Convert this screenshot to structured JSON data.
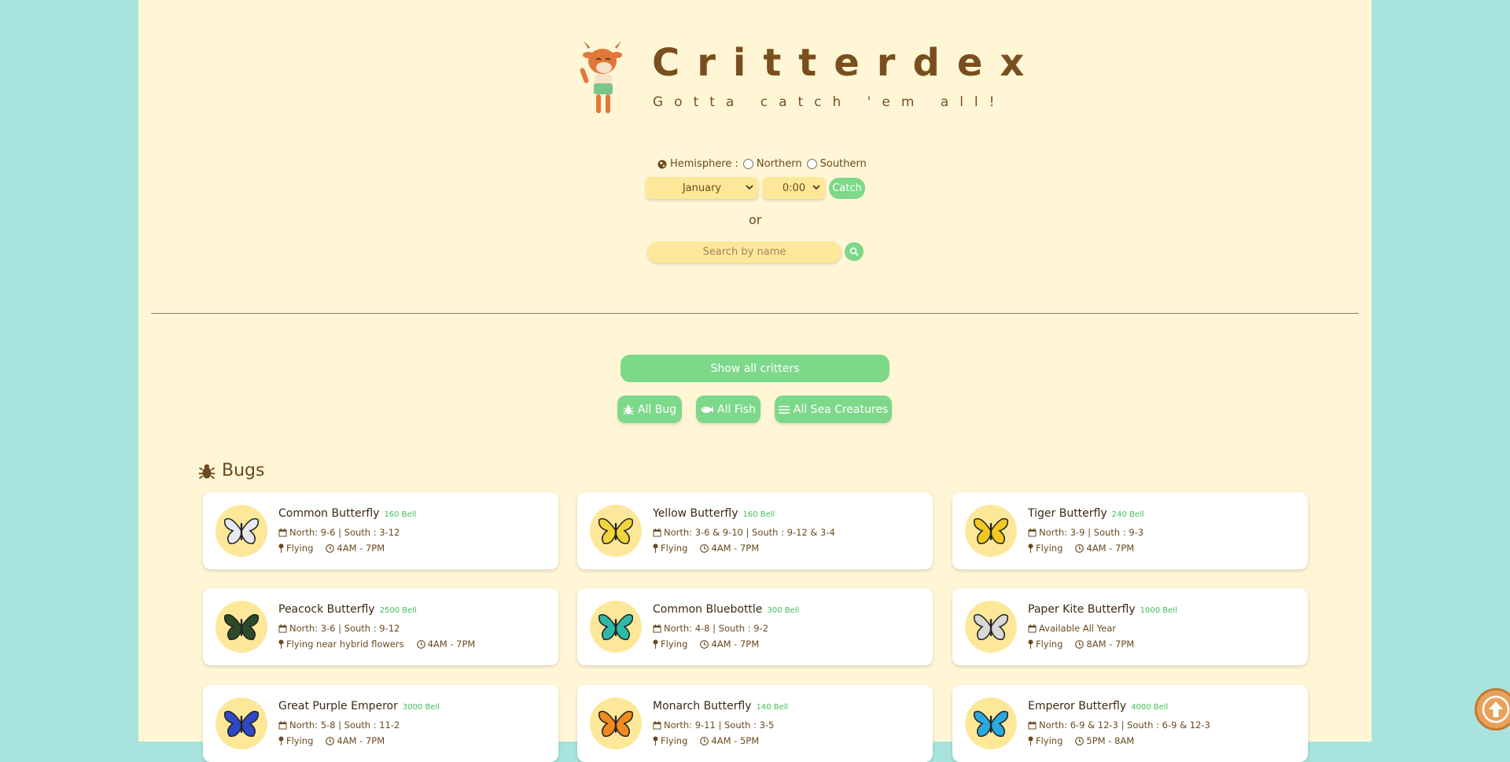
{
  "header": {
    "title": "Critterdex",
    "subtitle": "Gotta catch 'em all!"
  },
  "filter": {
    "hemisphere_label": "Hemisphere :",
    "northern_label": "Northern",
    "southern_label": "Southern",
    "month_value": "January",
    "time_value": "0:00",
    "catch_label": "Catch",
    "or_label": "or",
    "search_placeholder": "Search by name"
  },
  "nav": {
    "show_all_label": "Show all critters",
    "all_bug_label": "All Bug",
    "all_fish_label": "All Fish",
    "all_sea_label": "All Sea Creatures"
  },
  "section": {
    "title": "Bugs"
  },
  "cards": [
    {
      "name": "Common Butterfly",
      "price": "160 Bell",
      "season": "North: 9-6 | South : 3-12",
      "location": "Flying",
      "time": "4AM - 7PM",
      "color": "#e8e8f0"
    },
    {
      "name": "Yellow Butterfly",
      "price": "160 Bell",
      "season": "North: 3-6 & 9-10 | South : 9-12 & 3-4",
      "location": "Flying",
      "time": "4AM - 7PM",
      "color": "#f1d53a"
    },
    {
      "name": "Tiger Butterfly",
      "price": "240 Bell",
      "season": "North: 3-9 | South : 9-3",
      "location": "Flying",
      "time": "4AM - 7PM",
      "color": "#f3c820"
    },
    {
      "name": "Peacock Butterfly",
      "price": "2500 Bell",
      "season": "North: 3-6 | South : 9-12",
      "location": "Flying near hybrid flowers",
      "time": "4AM - 7PM",
      "color": "#2c4a2a"
    },
    {
      "name": "Common Bluebottle",
      "price": "300 Bell",
      "season": "North: 4-8 | South : 9-2",
      "location": "Flying",
      "time": "4AM - 7PM",
      "color": "#2fb8a8"
    },
    {
      "name": "Paper Kite Butterfly",
      "price": "1000 Bell",
      "season": "Available All Year",
      "location": "Flying",
      "time": "8AM - 7PM",
      "color": "#d8d8d8"
    },
    {
      "name": "Great Purple Emperor",
      "price": "3000 Bell",
      "season": "North: 5-8 | South : 11-2",
      "location": "Flying",
      "time": "4AM - 7PM",
      "color": "#2f48c8"
    },
    {
      "name": "Monarch Butterfly",
      "price": "140 Bell",
      "season": "North: 9-11 | South : 3-5",
      "location": "Flying",
      "time": "4AM - 5PM",
      "color": "#f08a20"
    },
    {
      "name": "Emperor Butterfly",
      "price": "4000 Bell",
      "season": "North: 6-9 & 12-3 | South : 6-9 & 12-3",
      "location": "Flying",
      "time": "5PM - 8AM",
      "color": "#2aa8e0"
    }
  ],
  "colors": {
    "background": "#a8e4dd",
    "page": "#fff6d6",
    "accent_green": "#7dd88a",
    "input_yellow": "#fde89a",
    "brown_text": "#7a4f1f",
    "price_green": "#3fbf55"
  }
}
